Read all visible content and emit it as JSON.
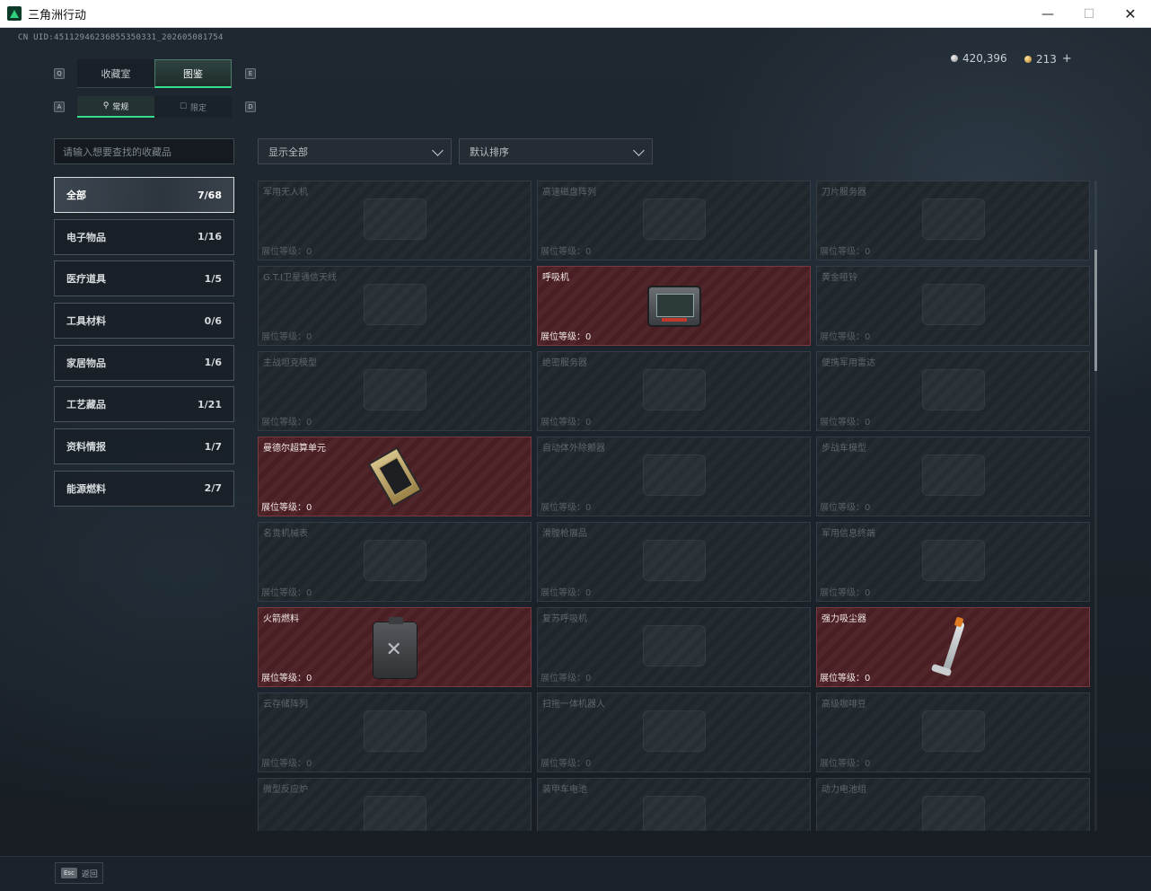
{
  "window": {
    "title": "三角洲行动",
    "minimize": "—",
    "maximize": "☐",
    "close": "✕"
  },
  "header": {
    "uid": "CN UID:45112946236855350331_202605081754",
    "currency": [
      {
        "icon": "silver-coin-icon",
        "value": "420,396"
      },
      {
        "icon": "gold-coin-icon",
        "value": "213"
      }
    ],
    "add_label": "+"
  },
  "key_hints": {
    "tab_left": "Q",
    "tab_right": "E",
    "sub_left": "A",
    "sub_right": "D"
  },
  "tabs": [
    {
      "label": "收藏室",
      "active": false
    },
    {
      "label": "图鉴",
      "active": true
    }
  ],
  "subtabs": [
    {
      "icon": "⚲",
      "label": "常规",
      "active": true
    },
    {
      "icon": "☐",
      "label": "限定",
      "active": false
    }
  ],
  "search": {
    "placeholder": "请输入想要查找的收藏品"
  },
  "filters": {
    "display": "显示全部",
    "sort": "默认排序"
  },
  "categories": [
    {
      "label": "全部",
      "count": "7/68",
      "active": true
    },
    {
      "label": "电子物品",
      "count": "1/16"
    },
    {
      "label": "医疗道具",
      "count": "1/5"
    },
    {
      "label": "工具材料",
      "count": "0/6"
    },
    {
      "label": "家居物品",
      "count": "1/6"
    },
    {
      "label": "工艺藏品",
      "count": "1/21"
    },
    {
      "label": "资料情报",
      "count": "1/7"
    },
    {
      "label": "能源燃料",
      "count": "2/7"
    }
  ],
  "level_label": "展位等级：",
  "items": [
    {
      "name": "军用无人机",
      "level": "0",
      "owned": false
    },
    {
      "name": "高速磁盘阵列",
      "level": "0",
      "owned": false
    },
    {
      "name": "刀片服务器",
      "level": "0",
      "owned": false
    },
    {
      "name": "G.T.I卫星通信天线",
      "level": "0",
      "owned": false
    },
    {
      "name": "呼吸机",
      "level": "0",
      "owned": true,
      "art": "resp"
    },
    {
      "name": "黄金哑铃",
      "level": "0",
      "owned": false
    },
    {
      "name": "主战坦克模型",
      "level": "0",
      "owned": false
    },
    {
      "name": "绝密服务器",
      "level": "0",
      "owned": false
    },
    {
      "name": "便携军用雷达",
      "level": "0",
      "owned": false
    },
    {
      "name": "曼德尔超算单元",
      "level": "0",
      "owned": true,
      "art": "chip"
    },
    {
      "name": "自动体外除颤器",
      "level": "0",
      "owned": false
    },
    {
      "name": "步战车模型",
      "level": "0",
      "owned": false
    },
    {
      "name": "名贵机械表",
      "level": "0",
      "owned": false
    },
    {
      "name": "滑膛枪展品",
      "level": "0",
      "owned": false
    },
    {
      "name": "军用信息终端",
      "level": "0",
      "owned": false
    },
    {
      "name": "火箭燃料",
      "level": "0",
      "owned": true,
      "art": "can"
    },
    {
      "name": "复苏呼吸机",
      "level": "0",
      "owned": false
    },
    {
      "name": "强力吸尘器",
      "level": "0",
      "owned": true,
      "art": "vac"
    },
    {
      "name": "云存储阵列",
      "level": "0",
      "owned": false
    },
    {
      "name": "扫拖一体机器人",
      "level": "0",
      "owned": false
    },
    {
      "name": "高级咖啡豆",
      "level": "0",
      "owned": false
    },
    {
      "name": "微型反应炉",
      "level": "",
      "owned": false
    },
    {
      "name": "装甲车电池",
      "level": "",
      "owned": false
    },
    {
      "name": "动力电池组",
      "level": "",
      "owned": false
    }
  ],
  "footer": {
    "esc_key": "Esc",
    "back_label": "返回"
  }
}
